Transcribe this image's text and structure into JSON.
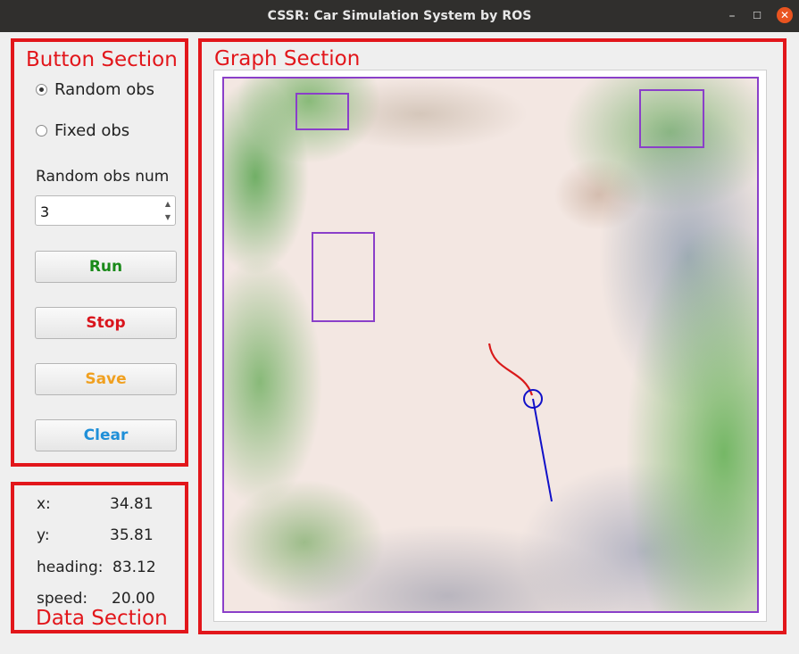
{
  "window": {
    "title": "CSSR: Car Simulation System by ROS"
  },
  "button_section": {
    "label": "Button Section",
    "radio_random": "Random obs",
    "radio_fixed": "Fixed obs",
    "selected": "random",
    "num_label": "Random obs num",
    "num_value": "3",
    "run": "Run",
    "stop": "Stop",
    "save": "Save",
    "clear": "Clear"
  },
  "data_section": {
    "label": "Data Section",
    "x_label": "x:",
    "x_value": "34.81",
    "y_label": "y:",
    "y_value": "35.81",
    "heading_label": "heading:",
    "heading_value": "83.12",
    "speed_label": "speed:",
    "speed_value": "20.00"
  },
  "graph_section": {
    "label": "Graph Section"
  },
  "colors": {
    "section_border": "#e2161b",
    "run": "#1a8a1a",
    "stop": "#d9141c",
    "save": "#f0a020",
    "clear": "#1f8fd8",
    "obstacle": "#8a3fc9",
    "trajectory": "#d91a1a",
    "car": "#1010c8"
  },
  "icons": {
    "minimize": "minimize-icon",
    "maximize": "maximize-icon",
    "close": "close-icon",
    "spin_up": "chevron-up-icon",
    "spin_down": "chevron-down-icon"
  }
}
